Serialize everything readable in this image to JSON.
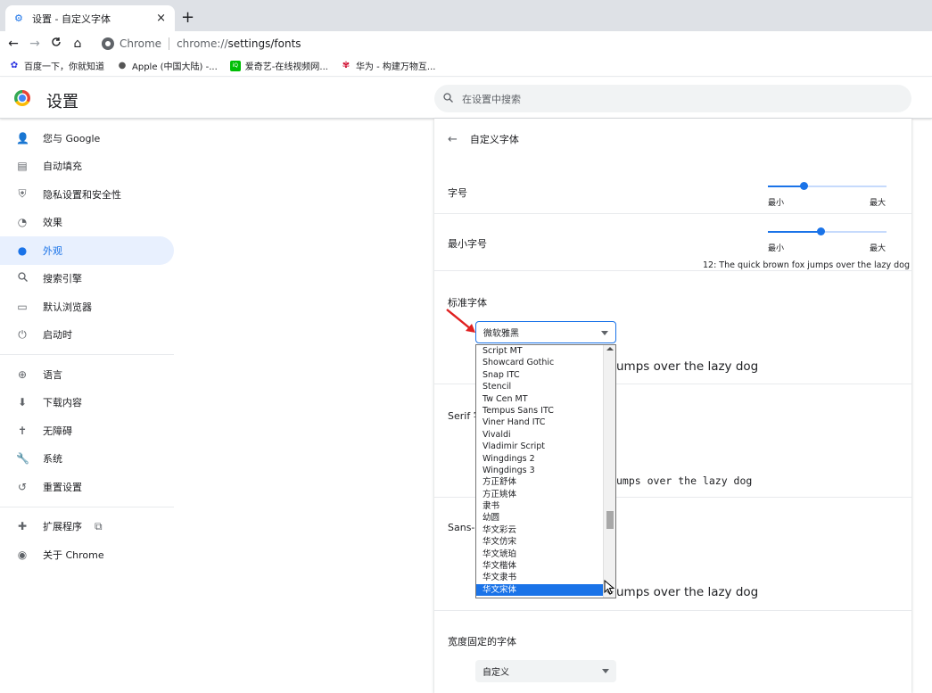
{
  "browser": {
    "tab_title": "设置 - 自定义字体",
    "tab_close": "×",
    "new_tab": "+",
    "nav": {
      "back": "←",
      "forward": "→",
      "reload": "C",
      "home": "⌂"
    },
    "omnibox": {
      "chip": "Chrome",
      "url_prefix": "chrome://",
      "url_host": "settings/fonts"
    },
    "bookmarks": [
      {
        "label": "百度一下，你就知道",
        "icon": "baidu-icon"
      },
      {
        "label": "Apple (中国大陆) -...",
        "icon": "apple-icon"
      },
      {
        "label": "爱奇艺-在线视频网...",
        "icon": "iqiyi-icon"
      },
      {
        "label": "华为 - 构建万物互...",
        "icon": "huawei-icon"
      }
    ]
  },
  "header": {
    "title": "设置",
    "search_placeholder": "在设置中搜索"
  },
  "sidebar": {
    "items": [
      {
        "label": "您与 Google",
        "icon": "person-icon"
      },
      {
        "label": "自动填充",
        "icon": "clipboard-icon"
      },
      {
        "label": "隐私设置和安全性",
        "icon": "shield-icon"
      },
      {
        "label": "效果",
        "icon": "speedometer-icon"
      },
      {
        "label": "外观",
        "icon": "palette-icon",
        "active": true
      },
      {
        "label": "搜索引擎",
        "icon": "search-icon"
      },
      {
        "label": "默认浏览器",
        "icon": "browser-icon"
      },
      {
        "label": "启动时",
        "icon": "power-icon"
      }
    ],
    "items2": [
      {
        "label": "语言",
        "icon": "globe-icon"
      },
      {
        "label": "下载内容",
        "icon": "download-icon"
      },
      {
        "label": "无障碍",
        "icon": "accessibility-icon"
      },
      {
        "label": "系统",
        "icon": "wrench-icon"
      },
      {
        "label": "重置设置",
        "icon": "restore-icon"
      }
    ],
    "items3": [
      {
        "label": "扩展程序",
        "icon": "puzzle-icon",
        "external_icon": "external-link-icon"
      },
      {
        "label": "关于 Chrome",
        "icon": "chrome-icon"
      }
    ]
  },
  "fonts_page": {
    "title": "自定义字体",
    "font_size_label": "字号",
    "font_size_min": "最小",
    "font_size_max": "最大",
    "font_size_level": 0.3,
    "min_font_size_label": "最小字号",
    "min_font_size_min": "最小",
    "min_font_size_max": "最大",
    "min_font_size_level": 0.44,
    "min_font_sample": "12: The quick brown fox jumps over the lazy dog",
    "standard_font_label": "标准字体",
    "standard_font_value": "微软雅黑",
    "standard_sample_tail": "umps over the lazy dog",
    "serif_label_partial": "Serif 字",
    "serif_sample_tail": "umps over the lazy dog",
    "sans_label_partial": "Sans-s",
    "sans_sample_tail": "umps over the lazy dog",
    "fixed_font_label": "宽度固定的字体",
    "fixed_font_value": "自定义"
  },
  "dropdown": {
    "options": [
      "Script MT",
      "Showcard Gothic",
      "Snap ITC",
      "Stencil",
      "Tw Cen MT",
      "Tempus Sans ITC",
      "Viner Hand ITC",
      "Vivaldi",
      "Vladimir Script",
      "Wingdings 2",
      "Wingdings 3",
      "方正舒体",
      "方正姚体",
      "隶书",
      "幼圆",
      "华文彩云",
      "华文仿宋",
      "华文琥珀",
      "华文楷体",
      "华文隶书",
      "华文宋体"
    ],
    "highlighted": "华文宋体"
  },
  "colors": {
    "accent": "#1a73e8",
    "active_bg": "#e8f0fe",
    "annotation_arrow": "#e02020"
  }
}
